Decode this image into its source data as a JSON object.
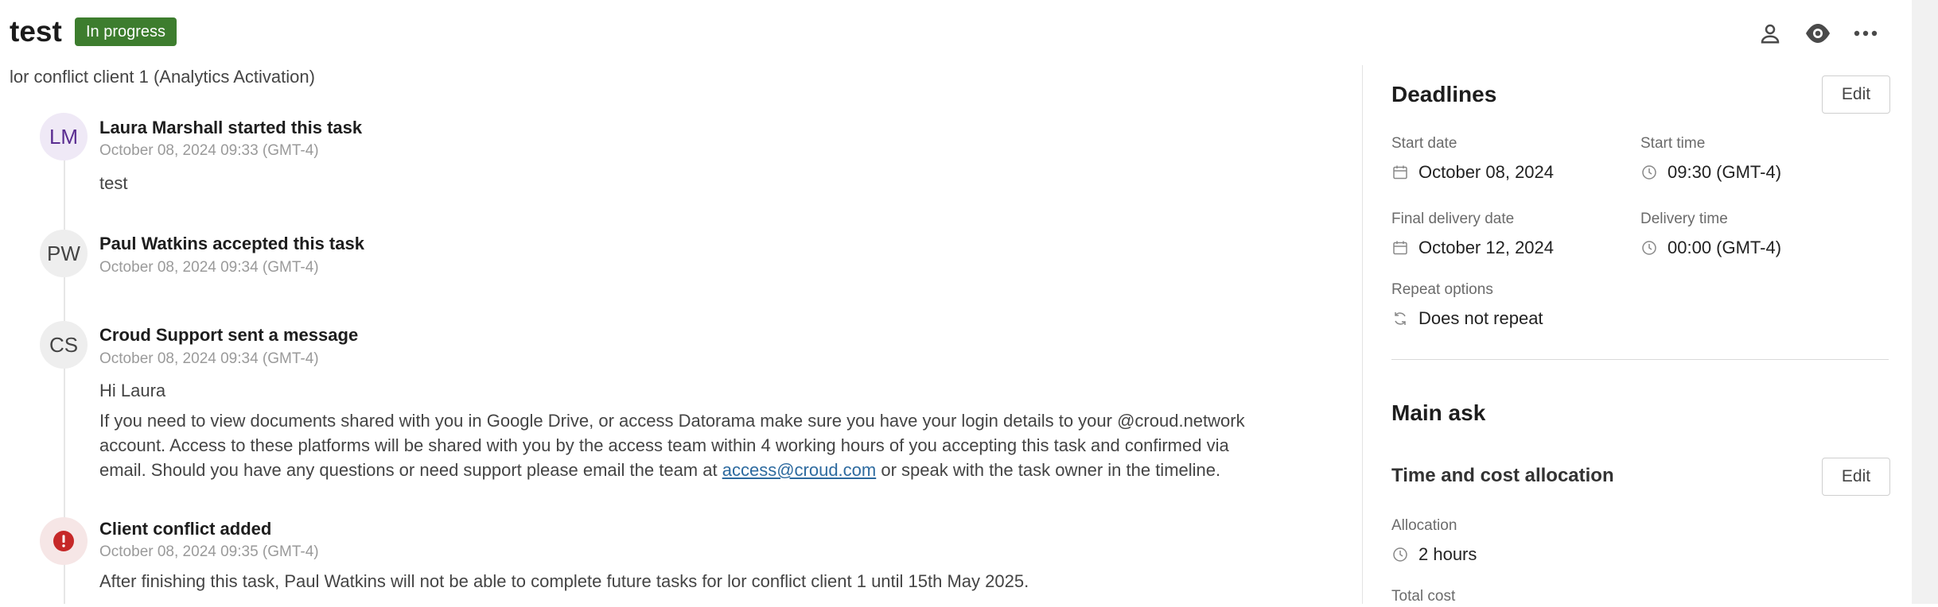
{
  "header": {
    "title": "test",
    "status": "In progress",
    "subtitle": "lor conflict client 1 (Analytics Activation)"
  },
  "timeline": {
    "events": [
      {
        "avatar": "LM",
        "title": "Laura Marshall started this task",
        "time": "October 08, 2024 09:33 (GMT-4)",
        "body": "test"
      },
      {
        "avatar": "PW",
        "title": "Paul Watkins accepted this task",
        "time": "October 08, 2024 09:34 (GMT-4)"
      },
      {
        "avatar": "CS",
        "title": "Croud Support sent a message",
        "time": "October 08, 2024 09:34 (GMT-4)",
        "greeting": "Hi Laura",
        "line1": "If you need to view documents shared with you in Google Drive, or access Datorama make sure you have your login details to your @croud.network",
        "line2": "account. Access to these platforms will be shared with you by the access team within 4 working hours of you accepting this task and confirmed via",
        "line3_before": "email. Should you have any questions or need support please email the team at ",
        "link": "access@croud.com",
        "line3_after": " or speak with the task owner in the timeline."
      },
      {
        "avatar_icon": "alert-icon",
        "title": "Client conflict added",
        "time": "October 08, 2024 09:35 (GMT-4)",
        "body": "After finishing this task, Paul Watkins will not be able to complete future tasks for lor conflict client 1 until 15th May 2025."
      }
    ]
  },
  "panel": {
    "deadlines": {
      "heading": "Deadlines",
      "edit": "Edit",
      "start_date_label": "Start date",
      "start_date": "October 08, 2024",
      "start_time_label": "Start time",
      "start_time": "09:30 (GMT-4)",
      "final_date_label": "Final delivery date",
      "final_date": "October 12, 2024",
      "delivery_time_label": "Delivery time",
      "delivery_time": "00:00 (GMT-4)",
      "repeat_label": "Repeat options",
      "repeat": "Does not repeat"
    },
    "main_ask": {
      "heading": "Main ask"
    },
    "allocation": {
      "heading": "Time and cost allocation",
      "edit": "Edit",
      "allocation_label": "Allocation",
      "allocation": "2 hours",
      "total_cost_label": "Total cost"
    }
  },
  "colors": {
    "status": "#3d7d2e",
    "alert": "#c62828",
    "link": "#2d6a9f"
  }
}
